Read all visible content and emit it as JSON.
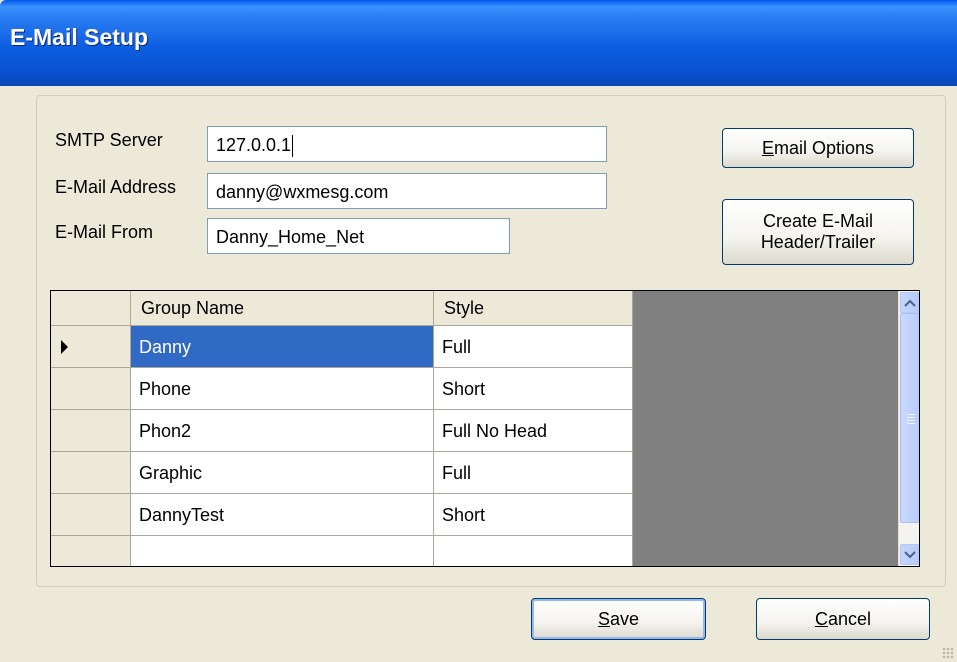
{
  "window": {
    "title": "E-Mail Setup"
  },
  "form": {
    "smtp_label": "SMTP Server",
    "smtp_value": "127.0.0.1",
    "address_label": "E-Mail Address",
    "address_value": "danny@wxmesg.com",
    "from_label": "E-Mail From",
    "from_value": "Danny_Home_Net"
  },
  "buttons": {
    "email_options": {
      "mnemonic": "E",
      "rest": "mail Options"
    },
    "create_header_line1": "Create E-Mail",
    "create_header_line2": "Header/Trailer",
    "save": {
      "mnemonic": "S",
      "rest": "ave"
    },
    "cancel": {
      "mnemonic": "C",
      "rest": "ancel"
    }
  },
  "grid": {
    "columns": [
      "Group Name",
      "Style"
    ],
    "rows": [
      {
        "group": "Danny",
        "style": "Full",
        "current": true
      },
      {
        "group": "Phone",
        "style": "Short"
      },
      {
        "group": "Phon2",
        "style": "Full No Head"
      },
      {
        "group": "Graphic",
        "style": "Full"
      },
      {
        "group": "DannyTest",
        "style": "Short"
      },
      {
        "group": "",
        "style": ""
      }
    ]
  },
  "icons": {
    "current_row": "row-pointer-icon",
    "scroll_up": "chevron-up-icon",
    "scroll_down": "chevron-down-icon"
  },
  "colors": {
    "title_bar": "#0a50d0",
    "selection": "#316ac5",
    "grid_background": "#808080"
  }
}
